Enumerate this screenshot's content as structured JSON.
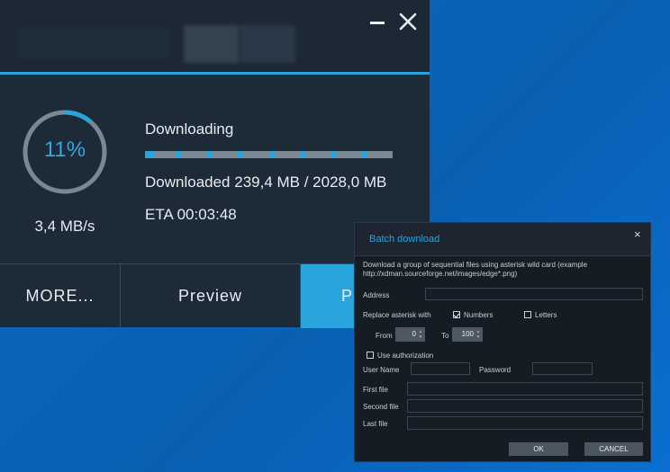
{
  "main": {
    "progress_percent": 11,
    "percent_label": "11%",
    "speed": "3,4 MB/s",
    "status": "Downloading",
    "downloaded": "Downloaded 239,4 MB / 2028,0 MB",
    "eta": "ETA 00:03:48",
    "buttons": {
      "more": "MORE...",
      "preview": "Preview",
      "partial": "P"
    },
    "colors": {
      "accent": "#2aa4dd",
      "background": "#1d2a37"
    }
  },
  "batch": {
    "title": "Batch download",
    "close": "×",
    "description": "Download a group of sequential files using asterisk wild card (example http://xdman.sourceforge.net/images/edge*.png)",
    "address_label": "Address",
    "address_value": "",
    "replace_label": "Replace asterisk with",
    "numbers_label": "Numbers",
    "numbers_checked": true,
    "letters_label": "Letters",
    "letters_checked": false,
    "from_label": "From",
    "from_value": "0",
    "to_label": "To",
    "to_value": "100",
    "auth_label": "Use authorization",
    "auth_checked": false,
    "username_label": "User Name",
    "password_label": "Password",
    "first_file_label": "First file",
    "second_file_label": "Second file",
    "last_file_label": "Last file",
    "ok": "OK",
    "cancel": "CANCEL"
  }
}
